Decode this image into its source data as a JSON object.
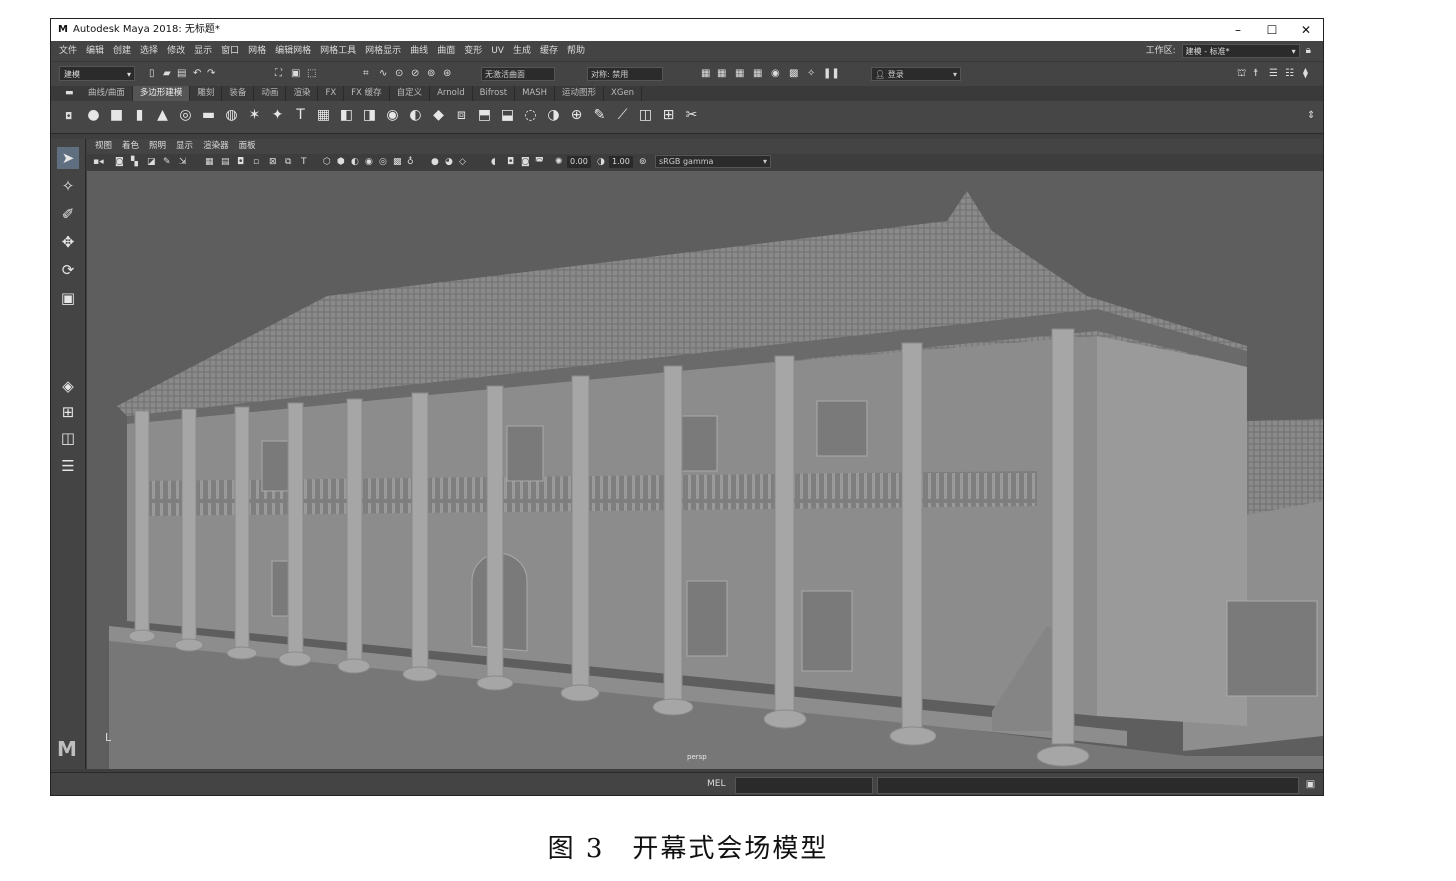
{
  "window": {
    "app_logo": "M",
    "title": "Autodesk Maya 2018: 无标题*",
    "controls": {
      "minimize": "–",
      "maximize": "☐",
      "close": "✕"
    }
  },
  "menubar": {
    "items": [
      "文件",
      "编辑",
      "创建",
      "选择",
      "修改",
      "显示",
      "窗口",
      "网格",
      "编辑网格",
      "网格工具",
      "网格显示",
      "曲线",
      "曲面",
      "变形",
      "UV",
      "生成",
      "缓存",
      "帮助"
    ],
    "workspace_label": "工作区:",
    "workspace_value": "建模 - 标准*"
  },
  "statusline": {
    "mode": "建模",
    "live_surface": "无激活曲面",
    "symmetry": "对称: 禁用",
    "login": "登录"
  },
  "shelf": {
    "tabs": [
      "曲线/曲面",
      "多边形建模",
      "雕刻",
      "装备",
      "动画",
      "渲染",
      "FX",
      "FX 缓存",
      "自定义",
      "Arnold",
      "Bifrost",
      "MASH",
      "运动图形",
      "XGen"
    ],
    "active_tab_index": 1,
    "icons": [
      "sphere-icon",
      "cube-icon",
      "cylinder-icon",
      "cone-icon",
      "torus-icon",
      "plane-icon",
      "disc-icon",
      "platonic-icon",
      "star-icon",
      "text-icon",
      "svg-icon",
      "combine-icon",
      "separate-icon",
      "smooth-icon",
      "extract-icon",
      "bevel-icon",
      "bridge-icon",
      "extrude-icon",
      "append-icon",
      "fill-hole-icon",
      "mirror-icon",
      "boolean-icon",
      "target-weld-icon",
      "multicut-icon",
      "quad-draw-icon",
      "uv-editor-icon",
      "unfold-icon"
    ],
    "icon_glyphs": [
      "●",
      "■",
      "▮",
      "▲",
      "◎",
      "▬",
      "◍",
      "✶",
      "✦",
      "T",
      "▦",
      "◧",
      "◨",
      "◉",
      "◐",
      "◆",
      "⧈",
      "⬒",
      "⬓",
      "◌",
      "◑",
      "⊕",
      "✎",
      "⟋",
      "◫",
      "⊞",
      "✂"
    ]
  },
  "toolbox": {
    "tools": [
      {
        "name": "select-tool-icon",
        "glyph": "➤"
      },
      {
        "name": "lasso-tool-icon",
        "glyph": "✧"
      },
      {
        "name": "paint-select-tool-icon",
        "glyph": "✐"
      },
      {
        "name": "move-tool-icon",
        "glyph": "✥"
      },
      {
        "name": "rotate-tool-icon",
        "glyph": "⟳"
      },
      {
        "name": "scale-tool-icon",
        "glyph": "▣"
      },
      {
        "name": "single-pane-layout-icon",
        "glyph": "◈"
      },
      {
        "name": "four-pane-layout-icon",
        "glyph": "⊞"
      },
      {
        "name": "two-pane-layout-icon",
        "glyph": "◫"
      },
      {
        "name": "outliner-layout-icon",
        "glyph": "☰"
      }
    ],
    "logo": "M"
  },
  "viewport_menu": {
    "items": [
      "视图",
      "着色",
      "照明",
      "显示",
      "渲染器",
      "面板"
    ]
  },
  "viewport_toolbar": {
    "exposure": "0.00",
    "gamma": "1.00",
    "color_space": "sRGB gamma"
  },
  "viewport": {
    "camera_label": "persp",
    "axis_label": "L"
  },
  "cmdline": {
    "label": "MEL"
  },
  "caption": "图 3　开幕式会场模型"
}
